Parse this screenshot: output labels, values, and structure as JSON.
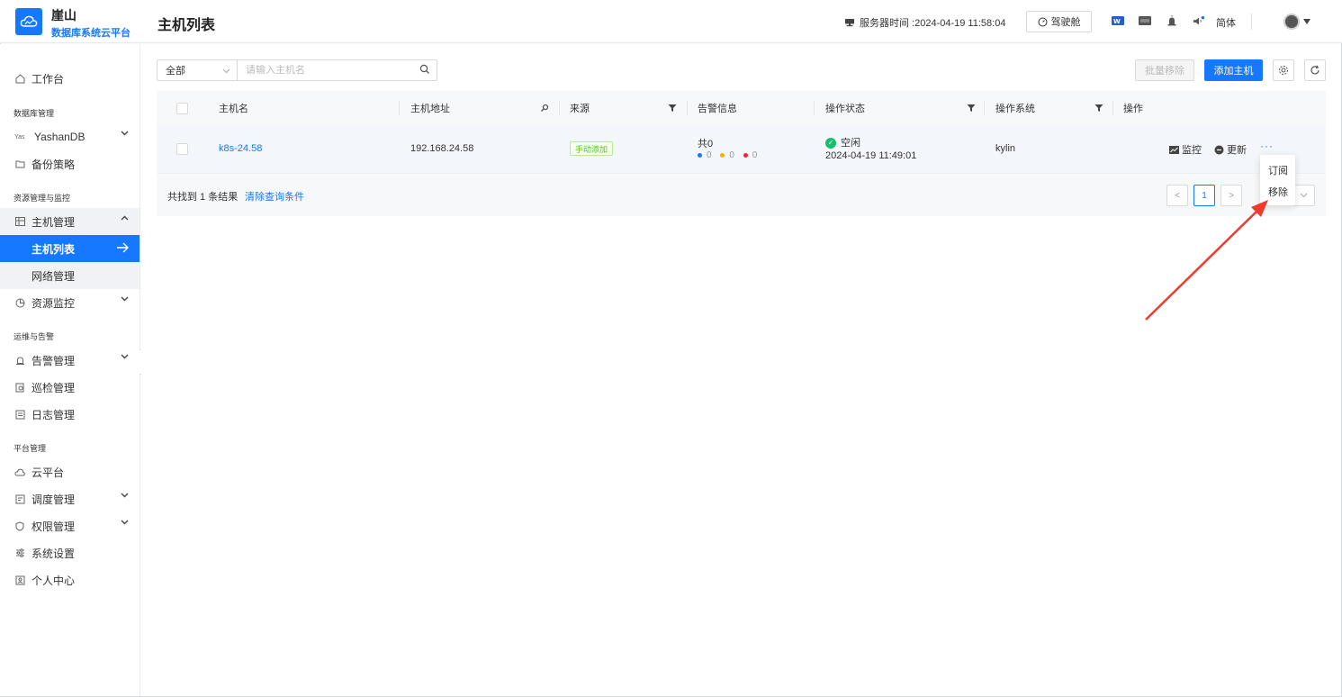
{
  "brand": {
    "title": "崖山",
    "subtitle": "数据库系统云平台"
  },
  "header": {
    "page_title": "主机列表",
    "server_time": "服务器时间 :2024-04-19 11:58:04",
    "cockpit_label": "驾驶舱",
    "lang": "简体",
    "icons": [
      "monitor-icon",
      "word-icon",
      "csv-icon",
      "alarm-icon",
      "speaker-icon",
      "avatar-icon"
    ]
  },
  "sidebar": {
    "workbench": "工作台",
    "groups": {
      "db": "数据库管理",
      "resource": "资源管理与监控",
      "ops": "运维与告警",
      "platform": "平台管理"
    },
    "items": {
      "yashandb": "YashanDB",
      "yashan_prefix": "Yas",
      "backup": "备份策略",
      "host_mgmt": "主机管理",
      "host_list": "主机列表",
      "network": "网络管理",
      "resource_monitor": "资源监控",
      "alarm": "告警管理",
      "inspection": "巡检管理",
      "log": "日志管理",
      "cloud": "云平台",
      "schedule": "调度管理",
      "permission": "权限管理",
      "settings": "系统设置",
      "personal": "个人中心"
    }
  },
  "toolbar": {
    "filter_value": "全部",
    "search_placeholder": "请输入主机名",
    "batch_remove": "批量移除",
    "add_host": "添加主机"
  },
  "table": {
    "columns": [
      "主机名",
      "主机地址",
      "来源",
      "告警信息",
      "操作状态",
      "操作系统",
      "操作"
    ],
    "rows": [
      {
        "hostname": "k8s-24.58",
        "address": "192.168.24.58",
        "source": "手动添加",
        "alarm_total": "共0",
        "alarm_blue": "0",
        "alarm_yellow": "0",
        "alarm_red": "0",
        "status": "空闲",
        "status_time": "2024-04-19 11:49:01",
        "os": "kylin",
        "action_monitor": "监控",
        "action_update": "更新",
        "action_more": "···"
      }
    ],
    "footer_prefix": "共找到 1 条结果",
    "clear_filter": "清除查询条件"
  },
  "pagination": {
    "prev": "<",
    "current": "1",
    "next": ">"
  },
  "dropdown": {
    "subscribe": "订阅",
    "remove": "移除"
  },
  "colors": {
    "primary": "#1677ff",
    "success": "#19be6b",
    "annotation_arrow": "#f03a2e"
  }
}
